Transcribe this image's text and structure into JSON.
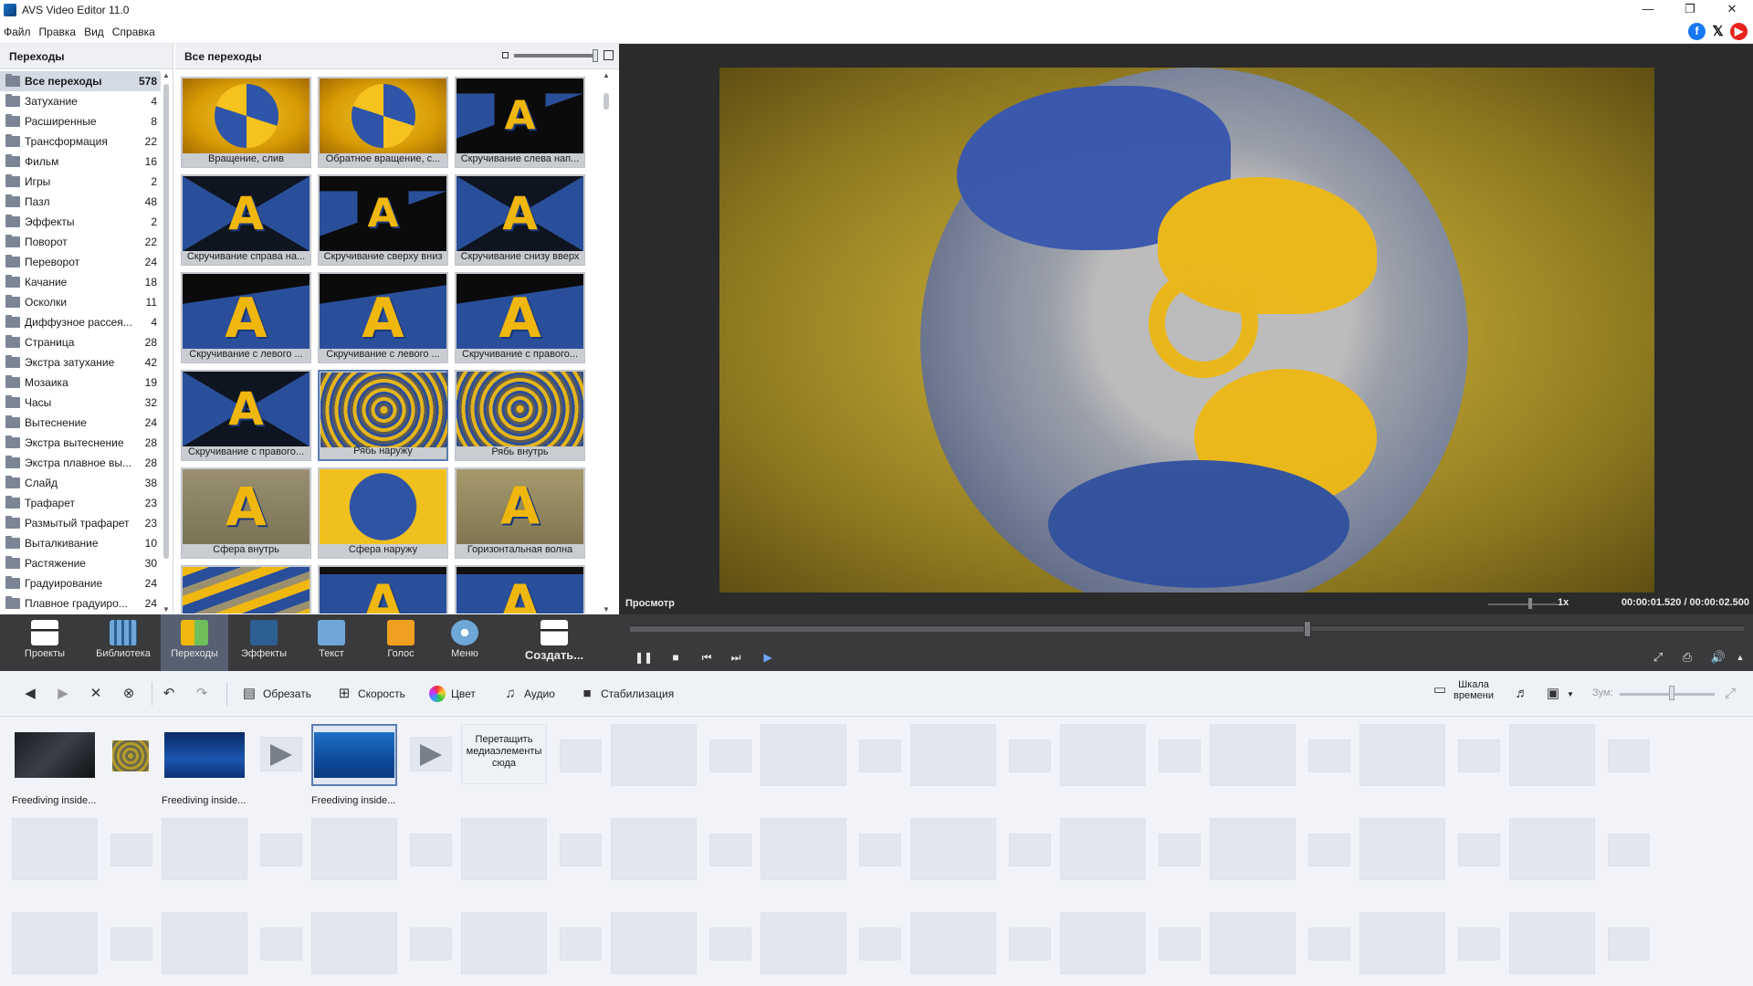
{
  "window": {
    "title": "AVS Video Editor 11.0",
    "controls": [
      "—",
      "❐",
      "✕"
    ]
  },
  "menu": [
    "Файл",
    "Правка",
    "Вид",
    "Справка"
  ],
  "social": [
    "facebook-icon",
    "x-icon",
    "youtube-icon"
  ],
  "categories": {
    "header": "Переходы",
    "items": [
      {
        "label": "Все переходы",
        "count": "578",
        "active": true
      },
      {
        "label": "Затухание",
        "count": "4"
      },
      {
        "label": "Расширенные",
        "count": "8"
      },
      {
        "label": "Трансформация",
        "count": "22"
      },
      {
        "label": "Фильм",
        "count": "16"
      },
      {
        "label": "Игры",
        "count": "2"
      },
      {
        "label": "Пазл",
        "count": "48"
      },
      {
        "label": "Эффекты",
        "count": "2"
      },
      {
        "label": "Поворот",
        "count": "22"
      },
      {
        "label": "Переворот",
        "count": "24"
      },
      {
        "label": "Качание",
        "count": "18"
      },
      {
        "label": "Осколки",
        "count": "11"
      },
      {
        "label": "Диффузное рассея...",
        "count": "4"
      },
      {
        "label": "Страница",
        "count": "28"
      },
      {
        "label": "Экстра затухание",
        "count": "42"
      },
      {
        "label": "Мозаика",
        "count": "19"
      },
      {
        "label": "Часы",
        "count": "32"
      },
      {
        "label": "Вытеснение",
        "count": "24"
      },
      {
        "label": "Экстра вытеснение",
        "count": "28"
      },
      {
        "label": "Экстра плавное вы...",
        "count": "28"
      },
      {
        "label": "Слайд",
        "count": "38"
      },
      {
        "label": "Трафарет",
        "count": "23"
      },
      {
        "label": "Размытый трафарет",
        "count": "23"
      },
      {
        "label": "Выталкивание",
        "count": "10"
      },
      {
        "label": "Растяжение",
        "count": "30"
      },
      {
        "label": "Градуирование",
        "count": "24"
      },
      {
        "label": "Плавное градуиро...",
        "count": "24"
      }
    ]
  },
  "transitions": {
    "header": "Все переходы",
    "tiles": [
      {
        "label": "Вращение, слив",
        "art": "swirl-gold"
      },
      {
        "label": "Обратное вращение, с...",
        "art": "swirl-gold"
      },
      {
        "label": "Скручивание слева нап...",
        "art": "a-black"
      },
      {
        "label": "Скручивание справа на...",
        "art": "a-blue-black"
      },
      {
        "label": "Скручивание сверху вниз",
        "art": "a-black"
      },
      {
        "label": "Скручивание снизу вверх",
        "art": "a-blue-black"
      },
      {
        "label": "Скручивание с левого ...",
        "art": "a-blue"
      },
      {
        "label": "Скручивание с левого ...",
        "art": "a-blue"
      },
      {
        "label": "Скручивание с правого...",
        "art": "a-blue"
      },
      {
        "label": "Скручивание с правого...",
        "art": "a-blue-black"
      },
      {
        "label": "Рябь наружу",
        "art": "ripple",
        "selected": true
      },
      {
        "label": "Рябь внутрь",
        "art": "ripple"
      },
      {
        "label": "Сфера внутрь",
        "art": "sphere-in"
      },
      {
        "label": "Сфера наружу",
        "art": "sphere-out"
      },
      {
        "label": "Горизонтальная волна",
        "art": "hwave"
      },
      {
        "label": "",
        "art": "wave-a"
      },
      {
        "label": "",
        "art": "film-a"
      },
      {
        "label": "",
        "art": "film-a"
      }
    ]
  },
  "preview": {
    "label": "Просмотр",
    "speed": "1x",
    "time_current": "00:00:01.520",
    "time_total": "/ 00:00:02.500",
    "progress": 0.608
  },
  "toolbar": {
    "items": [
      {
        "label": "Проекты",
        "icon": "clapper-icon"
      },
      {
        "label": "Библиотека",
        "icon": "film-strip-icon"
      },
      {
        "label": "Переходы",
        "icon": "transitions-icon",
        "active": true
      },
      {
        "label": "Эффекты",
        "icon": "effects-star-icon"
      },
      {
        "label": "Текст",
        "icon": "text-t-icon"
      },
      {
        "label": "Голос",
        "icon": "microphone-icon"
      },
      {
        "label": "Меню",
        "icon": "disc-menu-icon"
      },
      {
        "label": "Создать...",
        "icon": "create-clapper-icon"
      }
    ]
  },
  "edit_toolbar": {
    "cut": "Обрезать",
    "speed": "Скорость",
    "color": "Цвет",
    "audio": "Аудио",
    "stabilize": "Стабилизация",
    "timeline": "Шкала времени",
    "zoom": "Зум:"
  },
  "storyboard": {
    "clips": [
      {
        "label": "Freediving inside...",
        "art": "dark-cave"
      },
      {
        "label": "Freediving inside...",
        "art": "diver"
      },
      {
        "label": "Freediving inside...",
        "art": "underwater",
        "selected": true
      }
    ],
    "drop_hint": "Перетащить медиаэлементы сюда"
  },
  "colors": {
    "accent": "#576070",
    "dark_bg": "#3a3a3d",
    "preview_bg": "#2b2b2b",
    "selection": "#5b7db3"
  }
}
